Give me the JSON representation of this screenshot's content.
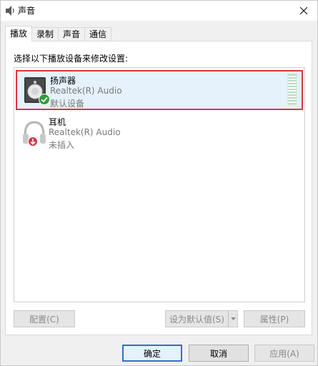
{
  "window": {
    "title": "声音",
    "icon": "speaker-icon",
    "close": "close-icon"
  },
  "tabs": [
    {
      "label": "播放",
      "active": true
    },
    {
      "label": "录制",
      "active": false
    },
    {
      "label": "声音",
      "active": false
    },
    {
      "label": "通信",
      "active": false
    }
  ],
  "panel": {
    "instruction": "选择以下播放设备来修改设置:",
    "devices": [
      {
        "name": "扬声器",
        "driver": "Realtek(R) Audio",
        "status": "默认设备",
        "icon": "speaker-device-icon",
        "badge": "default-check-icon",
        "selected": true
      },
      {
        "name": "耳机",
        "driver": "Realtek(R) Audio",
        "status": "未插入",
        "icon": "headphones-icon",
        "badge": "unplugged-arrow-icon",
        "selected": false
      }
    ],
    "buttons": {
      "configure": "配置(C)",
      "set_default": "设为默认值(S)",
      "properties": "属性(P)"
    }
  },
  "footer": {
    "ok": "确定",
    "cancel": "取消",
    "apply": "应用(A)"
  },
  "colors": {
    "selection_border": "#d9363e",
    "selection_fill": "#e5f1fb",
    "default_button_border": "#2f6fd0",
    "check_badge": "#2e9e3a",
    "unplugged_badge": "#d9363e"
  }
}
